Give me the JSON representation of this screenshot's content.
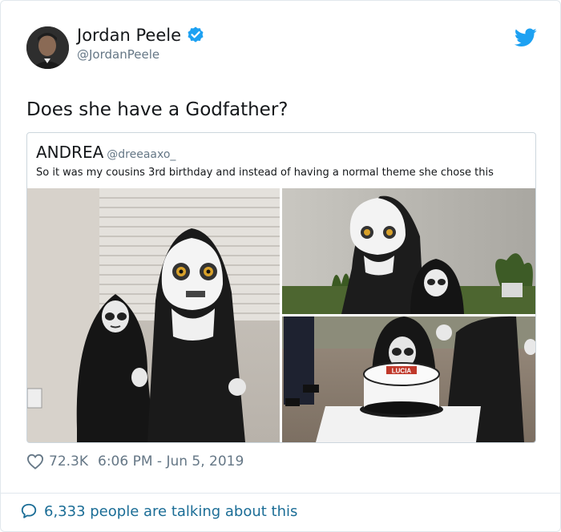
{
  "author": {
    "name": "Jordan Peele",
    "handle": "@JordanPeele",
    "verified": true
  },
  "tweet": {
    "text": "Does she have a Godfather?"
  },
  "quoted_tweet": {
    "name": "ANDREA",
    "handle": "@dreeaaxo_",
    "text": "So it was my cousins 3rd birthday and instead of having a normal theme she chose this",
    "cake_text": "LUCIA"
  },
  "meta": {
    "likes": "72.3K",
    "timestamp": "6:06 PM - Jun 5, 2019"
  },
  "footer": {
    "talking": "6,333 people are talking about this"
  },
  "icons": {
    "bird": "twitter-bird-icon",
    "verified": "verified-badge-icon",
    "heart": "heart-icon",
    "bubble": "speech-bubble-icon"
  },
  "colors": {
    "twitter_blue": "#1da1f2",
    "link_blue": "#1b6d96",
    "muted": "#657786",
    "border": "#e1e8ed"
  }
}
